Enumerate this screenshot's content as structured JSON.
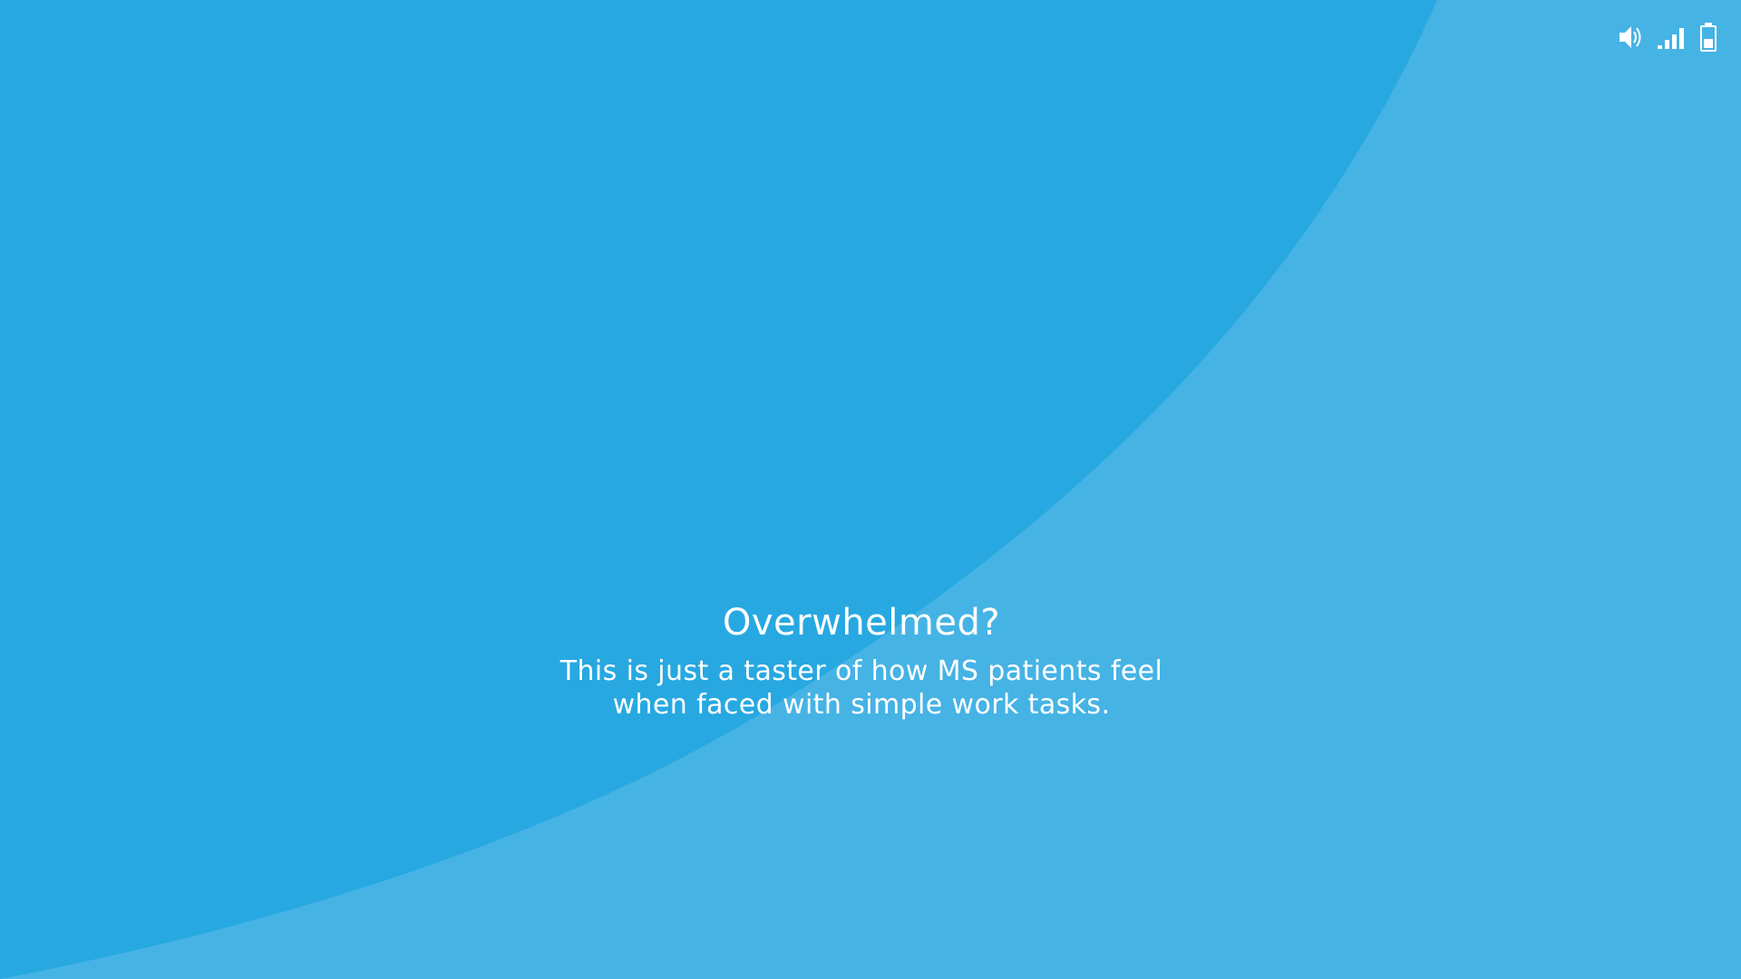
{
  "colors": {
    "background_light": "#46b3e5",
    "background_dark": "#27a8e1",
    "text": "#ffffff"
  },
  "status_bar": {
    "icons": [
      "volume-icon",
      "signal-icon",
      "battery-icon"
    ]
  },
  "message": {
    "title": "Overwhelmed?",
    "line1": "This is just a taster of how MS patients feel",
    "line2": "when faced with simple work tasks."
  }
}
